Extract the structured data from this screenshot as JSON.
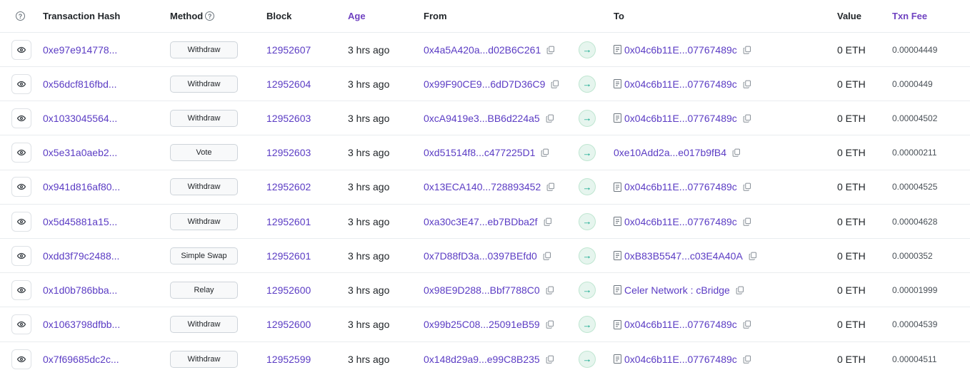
{
  "header": {
    "help_icon": "?",
    "tx_hash": "Transaction Hash",
    "method": "Method",
    "method_help_icon": "?",
    "block": "Block",
    "age": "Age",
    "from": "From",
    "to": "To",
    "value": "Value",
    "txn_fee": "Txn Fee"
  },
  "icons": {
    "view": "eye-icon",
    "copy": "copy-icon",
    "direction": "arrow-right-icon",
    "contract": "document-icon"
  },
  "colors": {
    "link": "#5b3cc4",
    "direction_bg": "#e6f5ee",
    "direction_fg": "#00a186"
  },
  "rows": [
    {
      "hash": "0xe97e914778...",
      "method": "Withdraw",
      "block": "12952607",
      "age": "3 hrs ago",
      "from": "0x4a5A420a...d02B6C261",
      "direction": "→",
      "to": "0x04c6b11E...07767489c",
      "to_is_contract": true,
      "value": "0 ETH",
      "fee": "0.00004449"
    },
    {
      "hash": "0x56dcf816fbd...",
      "method": "Withdraw",
      "block": "12952604",
      "age": "3 hrs ago",
      "from": "0x99F90CE9...6dD7D36C9",
      "direction": "→",
      "to": "0x04c6b11E...07767489c",
      "to_is_contract": true,
      "value": "0 ETH",
      "fee": "0.0000449"
    },
    {
      "hash": "0x1033045564...",
      "method": "Withdraw",
      "block": "12952603",
      "age": "3 hrs ago",
      "from": "0xcA9419e3...BB6d224a5",
      "direction": "→",
      "to": "0x04c6b11E...07767489c",
      "to_is_contract": true,
      "value": "0 ETH",
      "fee": "0.00004502"
    },
    {
      "hash": "0x5e31a0aeb2...",
      "method": "Vote",
      "block": "12952603",
      "age": "3 hrs ago",
      "from": "0xd51514f8...c477225D1",
      "direction": "→",
      "to": "0xe10Add2a...e017b9fB4",
      "to_is_contract": false,
      "value": "0 ETH",
      "fee": "0.00000211"
    },
    {
      "hash": "0x941d816af80...",
      "method": "Withdraw",
      "block": "12952602",
      "age": "3 hrs ago",
      "from": "0x13ECA140...728893452",
      "direction": "→",
      "to": "0x04c6b11E...07767489c",
      "to_is_contract": true,
      "value": "0 ETH",
      "fee": "0.00004525"
    },
    {
      "hash": "0x5d45881a15...",
      "method": "Withdraw",
      "block": "12952601",
      "age": "3 hrs ago",
      "from": "0xa30c3E47...eb7BDba2f",
      "direction": "→",
      "to": "0x04c6b11E...07767489c",
      "to_is_contract": true,
      "value": "0 ETH",
      "fee": "0.00004628"
    },
    {
      "hash": "0xdd3f79c2488...",
      "method": "Simple Swap",
      "block": "12952601",
      "age": "3 hrs ago",
      "from": "0x7D88fD3a...0397BEfd0",
      "direction": "→",
      "to": "0xB83B5547...c03E4A40A",
      "to_is_contract": true,
      "value": "0 ETH",
      "fee": "0.0000352"
    },
    {
      "hash": "0x1d0b786bba...",
      "method": "Relay",
      "block": "12952600",
      "age": "3 hrs ago",
      "from": "0x98E9D288...Bbf7788C0",
      "direction": "→",
      "to": "Celer Network : cBridge",
      "to_is_contract": true,
      "value": "0 ETH",
      "fee": "0.00001999"
    },
    {
      "hash": "0x1063798dfbb...",
      "method": "Withdraw",
      "block": "12952600",
      "age": "3 hrs ago",
      "from": "0x99b25C08...25091eB59",
      "direction": "→",
      "to": "0x04c6b11E...07767489c",
      "to_is_contract": true,
      "value": "0 ETH",
      "fee": "0.00004539"
    },
    {
      "hash": "0x7f69685dc2c...",
      "method": "Withdraw",
      "block": "12952599",
      "age": "3 hrs ago",
      "from": "0x148d29a9...e99C8B235",
      "direction": "→",
      "to": "0x04c6b11E...07767489c",
      "to_is_contract": true,
      "value": "0 ETH",
      "fee": "0.00004511"
    }
  ]
}
